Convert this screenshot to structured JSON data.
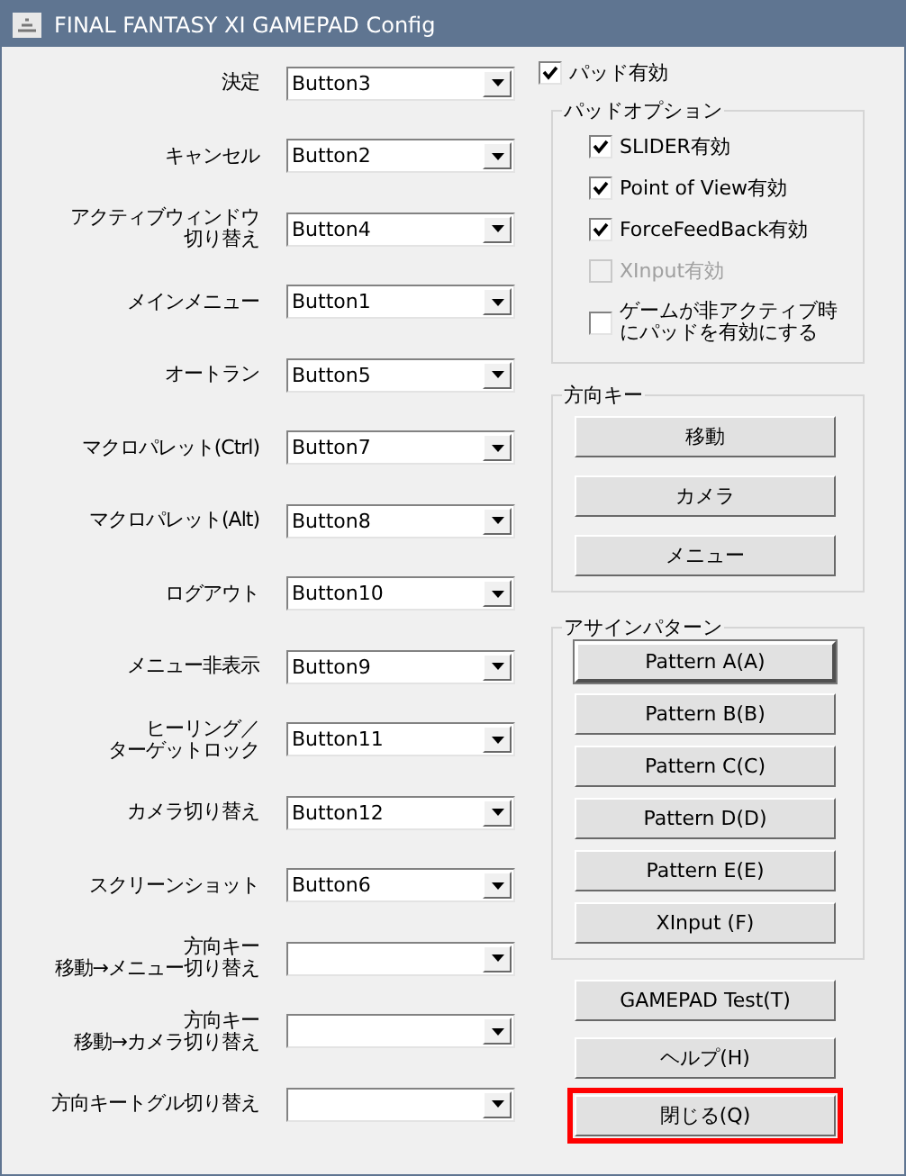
{
  "window": {
    "title": "FINAL FANTASY XI GAMEPAD Config"
  },
  "assignments": [
    {
      "label": [
        "決定"
      ],
      "value": "Button3"
    },
    {
      "label": [
        "キャンセル"
      ],
      "value": "Button2"
    },
    {
      "label": [
        "アクティブウィンドウ",
        "切り替え"
      ],
      "value": "Button4"
    },
    {
      "label": [
        "メインメニュー"
      ],
      "value": "Button1"
    },
    {
      "label": [
        "オートラン"
      ],
      "value": "Button5"
    },
    {
      "label": [
        "マクロパレット(Ctrl)"
      ],
      "value": "Button7"
    },
    {
      "label": [
        "マクロパレット(Alt)"
      ],
      "value": "Button8"
    },
    {
      "label": [
        "ログアウト"
      ],
      "value": "Button10"
    },
    {
      "label": [
        "メニュー非表示"
      ],
      "value": "Button9"
    },
    {
      "label": [
        "ヒーリング／",
        "ターゲットロック"
      ],
      "value": "Button11"
    },
    {
      "label": [
        "カメラ切り替え"
      ],
      "value": "Button12"
    },
    {
      "label": [
        "スクリーンショット"
      ],
      "value": "Button6"
    },
    {
      "label": [
        "方向キー",
        "移動→メニュー切り替え"
      ]
    },
    {
      "label": [
        "方向キー",
        "移動→カメラ切り替え"
      ]
    },
    {
      "label": [
        "方向キートグル切り替え"
      ]
    }
  ],
  "pad_enabled": {
    "label": [
      "パッド有効"
    ],
    "checked": true
  },
  "pad_options": {
    "title": "パッドオプション",
    "items": [
      {
        "label": [
          "SLIDER有効"
        ],
        "checked": true,
        "disabled": false
      },
      {
        "label": [
          "Point of View有効"
        ],
        "checked": true,
        "disabled": false
      },
      {
        "label": [
          "ForceFeedBack有効"
        ],
        "checked": true,
        "disabled": false
      },
      {
        "label": [
          "XInput有効"
        ],
        "checked": false,
        "disabled": true
      },
      {
        "label": [
          "ゲームが非アクティブ時",
          "にパッドを有効にする"
        ],
        "checked": false,
        "disabled": false
      }
    ]
  },
  "direction_keys": {
    "title": "方向キー",
    "buttons": [
      "移動",
      "カメラ",
      "メニュー"
    ]
  },
  "assign_patterns": {
    "title": "アサインパターン",
    "buttons": [
      {
        "label": "Pattern A(A)",
        "default": true
      },
      {
        "label": "Pattern B(B)",
        "default": false
      },
      {
        "label": "Pattern C(C)",
        "default": false
      },
      {
        "label": "Pattern D(D)",
        "default": false
      },
      {
        "label": "Pattern E(E)",
        "default": false
      },
      {
        "label": "XInput (F)",
        "default": false
      }
    ]
  },
  "actions": [
    {
      "label": "GAMEPAD Test(T)",
      "highlighted": false
    },
    {
      "label": "ヘルプ(H)",
      "highlighted": false
    },
    {
      "label": "閉じる(Q)",
      "highlighted": true
    }
  ]
}
